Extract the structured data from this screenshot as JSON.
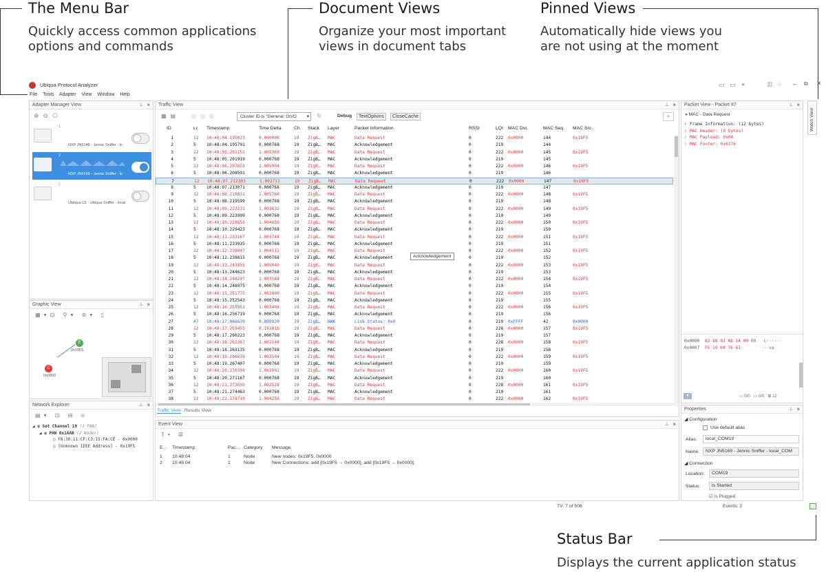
{
  "callouts": {
    "menu_bar": {
      "title": "The Menu Bar",
      "desc1": "Quickly access common applications",
      "desc2": "options and commands"
    },
    "document_views": {
      "title": "Document Views",
      "desc1": "Organize your most important",
      "desc2": "views in document tabs"
    },
    "pinned_views": {
      "title": "Pinned Views",
      "desc1": "Automatically hide views you",
      "desc2": "are not using at the moment"
    },
    "status_bar": {
      "title": "Status Bar",
      "desc1": "Displays the current application status"
    }
  },
  "app": {
    "title": "Ubiqua Protocol Analyzer",
    "menu": [
      "File",
      "Tools",
      "Adapter",
      "View",
      "Window",
      "Help"
    ]
  },
  "adapter_manager": {
    "title": "Adapter Manager View",
    "devices": [
      {
        "num": "1",
        "name": "NXP JN5148 - Jennic Sniffer - lo",
        "selected": false
      },
      {
        "num": "2",
        "name": "NXP JN5169 - Jennic Sniffer - lo",
        "selected": true
      },
      {
        "num": "1",
        "name": "Ubilqua U1 - Ubiqua Sniffer - local",
        "selected": false
      }
    ]
  },
  "graphic_view": {
    "title": "Graphic View",
    "nodes": [
      {
        "letter": "E",
        "label": "0x19F5",
        "color": "#4caf50"
      },
      {
        "letter": "C",
        "label": "0x0000",
        "color": "#e53935"
      }
    ]
  },
  "network_explorer": {
    "title": "Network Explorer",
    "tree": [
      {
        "text": "Set Channel 19",
        "note": "(1 PAN)"
      },
      {
        "text": "PAN 0x1AAB",
        "note": "(2 Nodes)"
      },
      {
        "text": "F8:30:11:CF:C3:15:FA:CE - 0x0000",
        "note": ""
      },
      {
        "text": "[Unknown  IEEE Address] - 0x19F5",
        "note": ""
      }
    ]
  },
  "traffic_view": {
    "title": "Traffic View",
    "filter": "Cluster ID is \"General: On/O",
    "debug_label": "Debug",
    "btn_text_options": "TextOptions",
    "btn_close_cache": "CloseCache",
    "columns": [
      "ID",
      "Lr.",
      "Timestamp",
      "Time Delta",
      "Ch.",
      "Stack",
      "Layer",
      "Packet Information",
      "RSSI",
      "LQI",
      "MAC Dst.",
      "MAC Seq.",
      "MAC Src."
    ],
    "tooltip": "Acknowledgement",
    "rows": [
      [
        "1",
        "12",
        "10:48:04.195023",
        "0.000000",
        "19",
        "ZigB…",
        "MAC",
        "Data Request",
        "0",
        "222",
        "0x0000",
        "144",
        "0x19F5",
        "r"
      ],
      [
        "2",
        "5",
        "10:48:04.195791",
        "0.000768",
        "19",
        "ZigB…",
        "MAC",
        "Acknowledgement",
        "0",
        "219",
        "",
        "144",
        "",
        "k"
      ],
      [
        "3",
        "12",
        "10:48:05.201151",
        "1.005360",
        "19",
        "ZigB…",
        "MAC",
        "Data Request",
        "0",
        "222",
        "0x0000",
        "145",
        "0x19F5",
        "r"
      ],
      [
        "4",
        "5",
        "10:48:05.201919",
        "0.000768",
        "19",
        "ZigB…",
        "MAC",
        "Acknowledgement",
        "0",
        "219",
        "",
        "145",
        "",
        "k"
      ],
      [
        "5",
        "12",
        "10:48:06.207823",
        "1.005904",
        "19",
        "ZigB…",
        "MAC",
        "Data Request",
        "0",
        "222",
        "0x0000",
        "146",
        "0x19F5",
        "r"
      ],
      [
        "6",
        "5",
        "10:48:06.208591",
        "0.000768",
        "19",
        "ZigB…",
        "MAC",
        "Acknowledgement",
        "0",
        "219",
        "",
        "146",
        "",
        "k"
      ],
      [
        "7",
        "12",
        "10:48:07.212303",
        "1.003712",
        "19",
        "ZigB…",
        "MAC",
        "Data Request",
        "0",
        "222",
        "0x0000",
        "147",
        "0x19F5",
        "r"
      ],
      [
        "8",
        "5",
        "10:48:07.213071",
        "0.000768",
        "19",
        "ZigB…",
        "MAC",
        "Acknowledgement",
        "0",
        "219",
        "",
        "147",
        "",
        "k"
      ],
      [
        "9",
        "12",
        "10:48:08.218831",
        "1.005760",
        "19",
        "ZigB…",
        "MAC",
        "Data Request",
        "0",
        "222",
        "0x0000",
        "148",
        "0x19F5",
        "r"
      ],
      [
        "10",
        "5",
        "10:48:08.219599",
        "0.000768",
        "19",
        "ZigB…",
        "MAC",
        "Acknowledgement",
        "0",
        "219",
        "",
        "148",
        "",
        "k"
      ],
      [
        "11",
        "12",
        "10:48:09.223231",
        "1.003632",
        "19",
        "ZigB…",
        "MAC",
        "Data Request",
        "0",
        "222",
        "0x0000",
        "149",
        "0x19F5",
        "r"
      ],
      [
        "12",
        "5",
        "10:48:09.223999",
        "0.000768",
        "19",
        "ZigB…",
        "MAC",
        "Acknowledgement",
        "0",
        "219",
        "",
        "149",
        "",
        "k"
      ],
      [
        "13",
        "12",
        "10:48:10.228655",
        "1.004656",
        "19",
        "ZigB…",
        "MAC",
        "Data Request",
        "0",
        "222",
        "0x0000",
        "150",
        "0x19F5",
        "r"
      ],
      [
        "14",
        "5",
        "10:48:10.229423",
        "0.000768",
        "19",
        "ZigB…",
        "MAC",
        "Acknowledgement",
        "0",
        "219",
        "",
        "150",
        "",
        "k"
      ],
      [
        "15",
        "12",
        "10:48:11.233167",
        "1.003744",
        "19",
        "ZigB…",
        "MAC",
        "Data Request",
        "0",
        "222",
        "0x0000",
        "151",
        "0x19F5",
        "r"
      ],
      [
        "16",
        "5",
        "10:48:11.233935",
        "0.000768",
        "19",
        "ZigB…",
        "MAC",
        "Acknowledgement",
        "0",
        "219",
        "",
        "151",
        "",
        "k"
      ],
      [
        "17",
        "12",
        "10:48:12.238047",
        "1.004112",
        "19",
        "ZigB…",
        "MAC",
        "Data Request",
        "0",
        "222",
        "0x0000",
        "152",
        "0x19F5",
        "r"
      ],
      [
        "18",
        "5",
        "10:48:12.238815",
        "0.000768",
        "19",
        "ZigB…",
        "MAC",
        "Acknowledgement",
        "0",
        "219",
        "",
        "152",
        "",
        "k"
      ],
      [
        "19",
        "12",
        "10:48:13.243855",
        "1.005040",
        "19",
        "ZigB…",
        "MAC",
        "Data Request",
        "0",
        "222",
        "0x0000",
        "153",
        "0x19F5",
        "r"
      ],
      [
        "20",
        "5",
        "10:48:13.244623",
        "0.000768",
        "19",
        "ZigB…",
        "MAC",
        "Acknowledgement",
        "0",
        "219",
        "",
        "153",
        "",
        "k"
      ],
      [
        "21",
        "12",
        "10:48:14.248207",
        "1.003584",
        "19",
        "ZigB…",
        "MAC",
        "Data Request",
        "0",
        "222",
        "0x0000",
        "154",
        "0x19F5",
        "r"
      ],
      [
        "22",
        "5",
        "10:48:14.248975",
        "0.000768",
        "19",
        "ZigB…",
        "MAC",
        "Acknowledgement",
        "0",
        "219",
        "",
        "154",
        "",
        "k"
      ],
      [
        "23",
        "12",
        "10:48:15.251775",
        "1.002800",
        "19",
        "ZigB…",
        "MAC",
        "Data Request",
        "0",
        "222",
        "0x0000",
        "155",
        "0x19F5",
        "r"
      ],
      [
        "24",
        "5",
        "10:48:15.252543",
        "0.000768",
        "19",
        "ZigB…",
        "MAC",
        "Acknowledgement",
        "0",
        "219",
        "",
        "155",
        "",
        "k"
      ],
      [
        "25",
        "12",
        "10:48:16.255951",
        "1.003408",
        "19",
        "ZigB…",
        "MAC",
        "Data Request",
        "0",
        "222",
        "0x0000",
        "156",
        "0x19F5",
        "r"
      ],
      [
        "26",
        "5",
        "10:48:16.256719",
        "0.000768",
        "19",
        "ZigB…",
        "MAC",
        "Acknowledgement",
        "0",
        "219",
        "",
        "156",
        "",
        "k"
      ],
      [
        "27",
        "47",
        "10:48:17.066639",
        "0.809920",
        "19",
        "ZigB…",
        "NWK",
        "Link Status: 0x0",
        "0",
        "219",
        "0xFFFF",
        "42",
        "0x0000",
        "b"
      ],
      [
        "28",
        "12",
        "10:48:17.259455",
        "0.192816",
        "19",
        "ZigB…",
        "MAC",
        "Data Request",
        "0",
        "228",
        "0x0000",
        "157",
        "0x19F5",
        "r"
      ],
      [
        "29",
        "5",
        "10:48:17.260223",
        "0.000768",
        "19",
        "ZigB…",
        "MAC",
        "Acknowledgement",
        "0",
        "219",
        "",
        "157",
        "",
        "k"
      ],
      [
        "30",
        "12",
        "10:48:18.262367",
        "1.002144",
        "19",
        "ZigB…",
        "MAC",
        "Data Request",
        "0",
        "228",
        "0x0000",
        "158",
        "0x19F5",
        "r"
      ],
      [
        "31",
        "5",
        "10:48:18.263135",
        "0.000768",
        "19",
        "ZigB…",
        "MAC",
        "Acknowledgement",
        "0",
        "219",
        "",
        "158",
        "",
        "k"
      ],
      [
        "32",
        "12",
        "10:48:19.266639",
        "1.003504",
        "19",
        "ZigB…",
        "MAC",
        "Data Request",
        "0",
        "222",
        "0x0000",
        "159",
        "0x19F5",
        "r"
      ],
      [
        "33",
        "5",
        "10:48:19.267407",
        "0.000768",
        "19",
        "ZigB…",
        "MAC",
        "Acknowledgement",
        "0",
        "219",
        "",
        "159",
        "",
        "k"
      ],
      [
        "34",
        "12",
        "10:48:20.270399",
        "1.002992",
        "19",
        "ZigB…",
        "MAC",
        "Data Request",
        "0",
        "222",
        "0x0000",
        "160",
        "0x19F5",
        "r"
      ],
      [
        "35",
        "5",
        "10:48:20.271167",
        "0.000768",
        "19",
        "ZigB…",
        "MAC",
        "Acknowledgement",
        "0",
        "219",
        "",
        "160",
        "",
        "k"
      ],
      [
        "36",
        "12",
        "10:48:21.273695",
        "1.002528",
        "19",
        "ZigB…",
        "MAC",
        "Data Request",
        "0",
        "228",
        "0x0000",
        "161",
        "0x19F5",
        "r"
      ],
      [
        "37",
        "5",
        "10:48:21.274463",
        "0.000768",
        "19",
        "ZigB…",
        "MAC",
        "Acknowledgement",
        "0",
        "219",
        "",
        "161",
        "",
        "k"
      ],
      [
        "38",
        "12",
        "10:48:22.278719",
        "1.004256",
        "19",
        "ZigB…",
        "MAC",
        "Data Request",
        "0",
        "222",
        "0x0000",
        "162",
        "0x19F5",
        "r"
      ]
    ],
    "tabs": [
      "Traffic View",
      "Results View"
    ]
  },
  "event_view": {
    "title": "Event View",
    "columns": [
      "E…",
      "Timestamp",
      "Pac…",
      "Category",
      "Message"
    ],
    "rows": [
      [
        "1",
        "10:48:04",
        "1",
        "Node",
        "New nodes: 0x19F5, 0x0000"
      ],
      [
        "2",
        "10:48:04",
        "1",
        "Node",
        "New Connections: add [0x19F5 → 0x0000], add [0x19F5 → 0x0000],"
      ]
    ]
  },
  "packet_view": {
    "title": "Packet View - Packet #7",
    "tab": "Watch View",
    "header": "MAC - Data Request",
    "lines": [
      {
        "text": "Frame Information: (12 bytes)",
        "color": "#333"
      },
      {
        "text": "MAC Header: (9 bytes)",
        "color": "#d83a3a"
      },
      {
        "text": "MAC Payload: 0x04",
        "color": "#d83a3a"
      },
      {
        "text": "MAC Footer: 0x6176",
        "color": "#d83a3a"
      }
    ],
    "hex": [
      {
        "addr": "0x0000",
        "bytes": "63 88 93 AB 1A 00 00",
        "ascii": "c······"
      },
      {
        "addr": "0x0007",
        "bytes": "F5 19 04 76 61",
        "ascii": "···va"
      }
    ],
    "footer": [
      "0/0",
      "0/0",
      "12"
    ]
  },
  "properties": {
    "title": "Properties",
    "section_config": "Configuration",
    "use_default_alias": "Use default alias",
    "alias_label": "Alias:",
    "alias_value": "local_COM19",
    "name_label": "Name:",
    "name_value": "NXP JN5169 - Jennic Sniffer - local_COM",
    "section_connection": "Connection",
    "location_label": "Location:",
    "location_value": "COM19",
    "status_label": "Status:",
    "status_value": "Is Started",
    "is_plugged": "Is Plugged"
  },
  "status_bar": {
    "tv": "TV: 7 of 506",
    "events": "Events: 2"
  },
  "colors": {
    "accent": "#3d8fe0",
    "red": "#d83a3a",
    "blue": "#3a62c8",
    "selected_row": "#dbe9f8"
  }
}
